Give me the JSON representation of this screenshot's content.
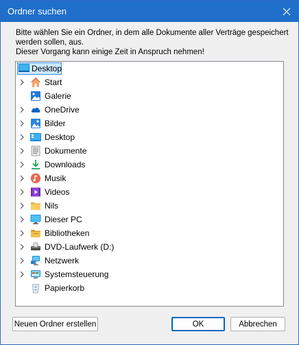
{
  "window": {
    "title": "Ordner suchen"
  },
  "instructions": {
    "line1": "Bitte wählen Sie ein Ordner, in dem alle Dokumente aller Verträge gespeichert",
    "line2": "werden sollen, aus.",
    "line3": "Dieser Vorgang kann einige Zeit in Anspruch nehmen!"
  },
  "tree": {
    "root": {
      "label": "Desktop",
      "icon": "desktop-icon",
      "selected": true
    },
    "items": [
      {
        "label": "Start",
        "icon": "home-icon",
        "expandable": true
      },
      {
        "label": "Galerie",
        "icon": "gallery-icon",
        "expandable": false
      },
      {
        "label": "OneDrive",
        "icon": "cloud-icon",
        "expandable": true
      },
      {
        "label": "Bilder",
        "icon": "pictures-icon",
        "expandable": true
      },
      {
        "label": "Desktop",
        "icon": "desktop-icon",
        "expandable": true
      },
      {
        "label": "Dokumente",
        "icon": "documents-icon",
        "expandable": true
      },
      {
        "label": "Downloads",
        "icon": "download-icon",
        "expandable": true
      },
      {
        "label": "Musik",
        "icon": "music-icon",
        "expandable": true
      },
      {
        "label": "Videos",
        "icon": "video-icon",
        "expandable": true
      },
      {
        "label": "Nils",
        "icon": "folder-icon",
        "expandable": true
      },
      {
        "label": "Dieser PC",
        "icon": "monitor-icon",
        "expandable": true
      },
      {
        "label": "Bibliotheken",
        "icon": "libraries-icon",
        "expandable": true
      },
      {
        "label": "DVD-Laufwerk (D:)",
        "icon": "dvd-drive-icon",
        "expandable": true
      },
      {
        "label": "Netzwerk",
        "icon": "network-icon",
        "expandable": true
      },
      {
        "label": "Systemsteuerung",
        "icon": "control-panel-icon",
        "expandable": true
      },
      {
        "label": "Papierkorb",
        "icon": "recycle-bin-icon",
        "expandable": false
      }
    ]
  },
  "buttons": {
    "new_folder": "Neuen Ordner erstellen",
    "ok": "OK",
    "cancel": "Abbrechen"
  },
  "colors": {
    "titlebar": "#1f6fcb",
    "selection": "#cce8ff",
    "selection_border": "#3d8ee0",
    "ok_border": "#0067c0"
  }
}
